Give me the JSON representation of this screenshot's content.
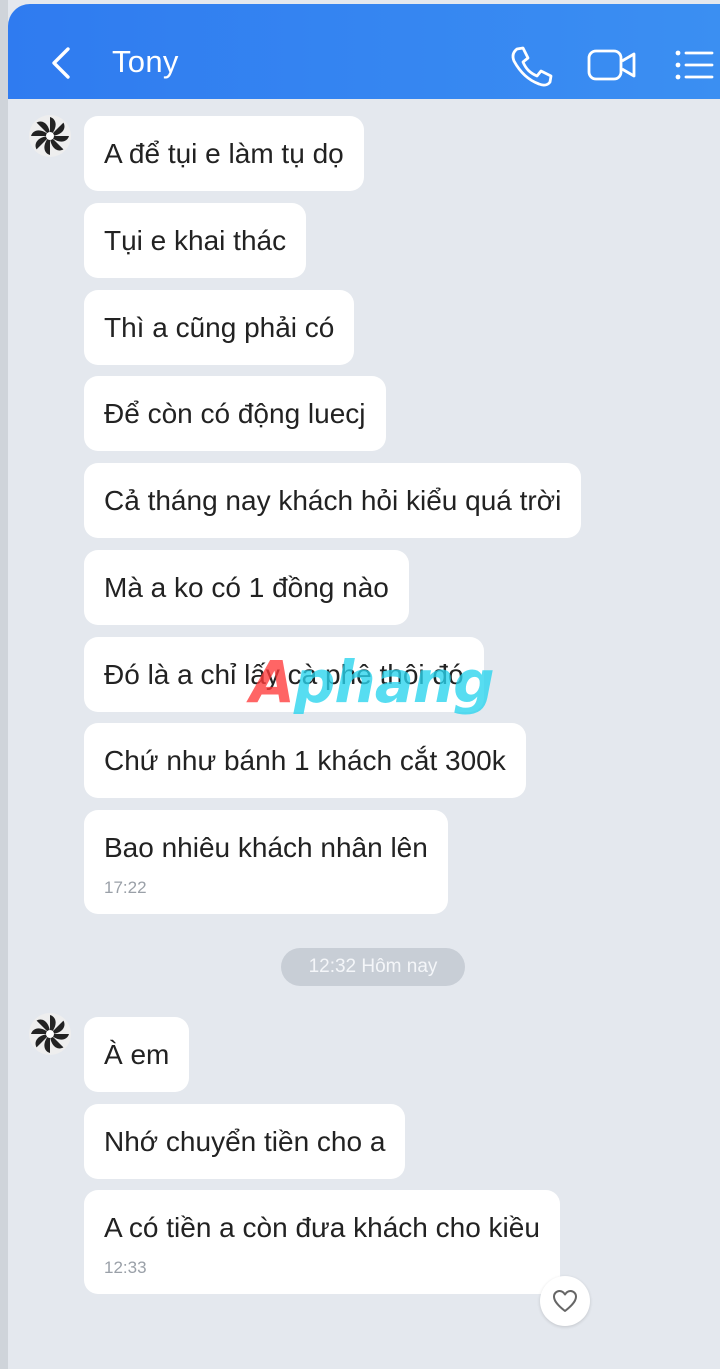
{
  "header": {
    "title": "Tony",
    "back_icon": "chevron-left-icon",
    "call_icon": "phone-icon",
    "video_icon": "video-camera-icon",
    "menu_icon": "list-menu-icon",
    "color": "#3483f1"
  },
  "group1": {
    "messages": [
      {
        "text": "A để tụi e làm tụ dọ"
      },
      {
        "text": "Tụi e khai thác"
      },
      {
        "text": "Thì a cũng phải có"
      },
      {
        "text": "Để còn có động luecj"
      },
      {
        "text": "Cả tháng nay khách hỏi kiểu quá trời"
      },
      {
        "text": "Mà a ko có 1 đồng nào"
      },
      {
        "text": "Đó là a chỉ lấy cà phê thôi đó"
      },
      {
        "text": "Chứ như bánh 1 khách cắt 300k"
      },
      {
        "text": "Bao nhiêu khách nhân lên",
        "time": "17:22"
      }
    ]
  },
  "divider": {
    "label": "12:32 Hôm nay"
  },
  "group2": {
    "messages": [
      {
        "text": "À em"
      },
      {
        "text": "Nhớ chuyển tiền cho a"
      },
      {
        "text": "A có tiền a còn đưa khách cho kiều",
        "time": "12:33"
      }
    ]
  },
  "reaction": {
    "icon": "heart-icon"
  },
  "watermark": {
    "part1": "A",
    "part2": "phang"
  }
}
